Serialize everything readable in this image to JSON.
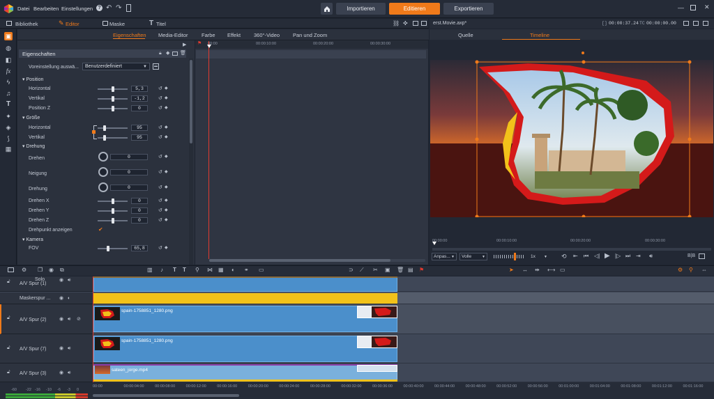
{
  "app": {
    "menu": [
      "Datei",
      "Bearbeiten",
      "Einstellungen"
    ],
    "nav": {
      "import": "Importieren",
      "edit": "Editieren",
      "export": "Exportieren"
    },
    "brand_color": "#f07a1a"
  },
  "section_tabs": {
    "library": "Bibliothek",
    "editor": "Editor",
    "mask": "Maske",
    "title": "Titel"
  },
  "editor_tabs": [
    "Eigenschaften",
    "Media-Editor",
    "Farbe",
    "Effekt",
    "360°-Video",
    "Pan und Zoom"
  ],
  "properties": {
    "header": "Eigenschaften",
    "preset_label": "Voreinstellung auswä...",
    "preset_value": "Benutzerdefiniert",
    "position": {
      "title": "Position",
      "horizontal_label": "Horizontal",
      "horizontal_value": "5,3",
      "vertical_label": "Vertikal",
      "vertical_value": "-1,2",
      "z_label": "Position Z",
      "z_value": "0"
    },
    "size": {
      "title": "Größe",
      "horizontal_label": "Horizontal",
      "horizontal_value": "95",
      "vertical_label": "Vertikal",
      "vertical_value": "95"
    },
    "rotation": {
      "title": "Drehung",
      "rotate_label": "Drehen",
      "rotate_value": "0",
      "tilt_label": "Neigung",
      "tilt_value": "0",
      "spin_label": "Drehung",
      "spin_value": "0",
      "x_label": "Drehen X",
      "x_value": "0",
      "y_label": "Drehen Y",
      "y_value": "0",
      "z_label": "Drehen Z",
      "z_value": "0",
      "pivot_label": "Drehpunkt anzeigen"
    },
    "camera": {
      "title": "Kamera",
      "fov_label": "FOV",
      "fov_value": "65,8"
    }
  },
  "kf_ruler": [
    "00:00",
    "00:00:10:00",
    "00:00:20:00",
    "00:00:30:00"
  ],
  "preview": {
    "file": "erst.Movie.axp*",
    "timecode_duration": "00:00:37.24",
    "timecode_current": "00:00:00.00",
    "tab_source": "Quelle",
    "tab_timeline": "Timeline",
    "scrub_ticks": [
      "00:00:00",
      "00:00:10:00",
      "00:00:20:00",
      "00:00:30:00"
    ],
    "fit_label": "Anpas...",
    "quality_label": "Volle",
    "speed_label": "1x"
  },
  "tracks": [
    {
      "name": "A/V Spur (1)",
      "solo": "Solo",
      "clip": ""
    },
    {
      "name": "Maskerspur ...",
      "clip": ""
    },
    {
      "name": "A/V Spur (2)",
      "clip": "spain-1758851_1280.png"
    },
    {
      "name": "A/V Spur (7)",
      "clip": "spain-1758851_1280.png"
    },
    {
      "name": "A/V Spur (3)",
      "clip": "sateen_jorge.mp4"
    }
  ],
  "timeline_ticks": [
    "00:00",
    "00:00:04:00",
    "00:00:08:00",
    "00:00:12:00",
    "00:00:16:00",
    "00:00:20:00",
    "00:00:24:00",
    "00:00:28:00",
    "00:00:32:00",
    "00:00:36:00",
    "00:00:40:00",
    "00:00:44:00",
    "00:00:48:00",
    "00:00:52:00",
    "00:00:56:00",
    "00:01:00:00",
    "00:01:04:00",
    "00:01:08:00",
    "00:01:12:00",
    "00:01:16:00"
  ],
  "meter_labels": [
    "-60",
    "-22",
    "-16",
    "-10",
    "-6",
    "-3",
    "0"
  ]
}
